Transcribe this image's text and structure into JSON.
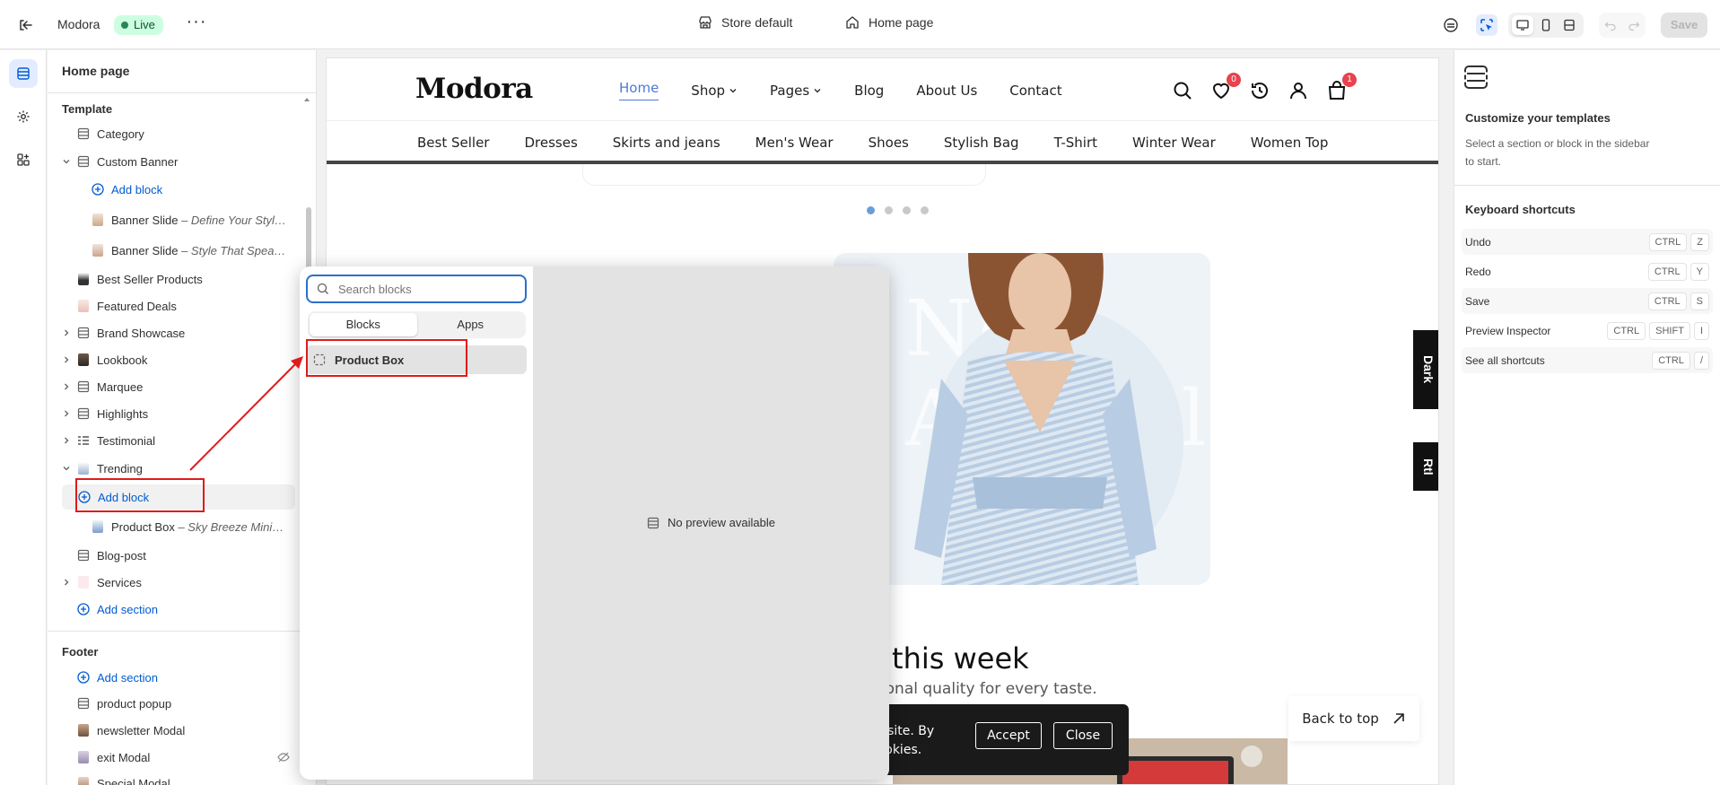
{
  "topbar": {
    "app_name": "Modora",
    "status_badge": "Live",
    "store_label": "Store default",
    "page_label": "Home page",
    "save_label": "Save"
  },
  "sidebar": {
    "title": "Home page",
    "template_heading": "Template",
    "footer_heading": "Footer",
    "items": [
      {
        "label": "Category",
        "icon": "section-icon"
      },
      {
        "label": "Custom Banner",
        "icon": "section-icon"
      },
      {
        "label": "Add block",
        "icon": "plus-circle-icon"
      },
      {
        "label": "Banner Slide",
        "sub": "– Define Your Style...",
        "icon": "image-thumb"
      },
      {
        "label": "Banner Slide",
        "sub": "– Style That Speak...",
        "icon": "image-thumb"
      },
      {
        "label": "Best Seller Products",
        "icon": "image-thumb"
      },
      {
        "label": "Featured Deals",
        "icon": "image-thumb"
      },
      {
        "label": "Brand Showcase",
        "icon": "section-icon"
      },
      {
        "label": "Lookbook",
        "icon": "image-thumb"
      },
      {
        "label": "Marquee",
        "icon": "section-icon"
      },
      {
        "label": "Highlights",
        "icon": "section-icon"
      },
      {
        "label": "Testimonial",
        "icon": "list-icon"
      },
      {
        "label": "Trending",
        "icon": "image-thumb"
      },
      {
        "label": "Add block",
        "icon": "plus-circle-icon"
      },
      {
        "label": "Product Box",
        "sub": "– Sky Breeze Mini D...",
        "icon": "image-thumb"
      },
      {
        "label": "Blog-post",
        "icon": "section-icon"
      },
      {
        "label": "Services",
        "icon": "image-thumb"
      },
      {
        "label": "Add section",
        "icon": "plus-circle-icon"
      }
    ],
    "footer_items": [
      {
        "label": "Add section",
        "icon": "plus-circle-icon"
      },
      {
        "label": "product popup",
        "icon": "section-icon"
      },
      {
        "label": "newsletter Modal",
        "icon": "image-thumb"
      },
      {
        "label": "exit Modal",
        "icon": "image-thumb"
      },
      {
        "label": "Special Modal",
        "icon": "image-thumb"
      }
    ]
  },
  "picker": {
    "search_placeholder": "Search blocks",
    "tabs": [
      "Blocks",
      "Apps"
    ],
    "block_item": "Product Box",
    "no_preview": "No preview available"
  },
  "site": {
    "logo": "Modora",
    "nav": [
      "Home",
      "Shop",
      "Pages",
      "Blog",
      "About Us",
      "Contact"
    ],
    "wishlist_count": "0",
    "cart_count": "1",
    "categories": [
      "Best Seller",
      "Dresses",
      "Skirts and jeans",
      "Men's Wear",
      "Shoes",
      "Stylish Bag",
      "T-Shirt",
      "Winter Wear",
      "Women Top"
    ],
    "hero_bg_text": "New Arrivals",
    "section_title": "of this week",
    "section_subtitle": "eptional quality for every taste.",
    "cookie_text_1": "ur site. By",
    "cookie_text_2": "cookies.",
    "accept_label": "Accept",
    "close_label": "Close",
    "back_to_top": "Back to top",
    "dark_tab": "Dark",
    "rtl_tab": "Rtl"
  },
  "rightpanel": {
    "title": "Customize your templates",
    "description": "Select a section or block in the sidebar to start.",
    "shortcuts_title": "Keyboard shortcuts",
    "shortcuts": [
      {
        "label": "Undo",
        "keys": [
          "CTRL",
          "Z"
        ]
      },
      {
        "label": "Redo",
        "keys": [
          "CTRL",
          "Y"
        ]
      },
      {
        "label": "Save",
        "keys": [
          "CTRL",
          "S"
        ]
      },
      {
        "label": "Preview Inspector",
        "keys": [
          "CTRL",
          "SHIFT",
          "I"
        ]
      },
      {
        "label": "See all shortcuts",
        "keys": [
          "CTRL",
          "/"
        ]
      }
    ]
  },
  "colors": {
    "accent": "#005bd3",
    "highlight_red": "#e01b1b",
    "live_bg": "#cdfee1",
    "nav_active": "#4a7bd4"
  }
}
